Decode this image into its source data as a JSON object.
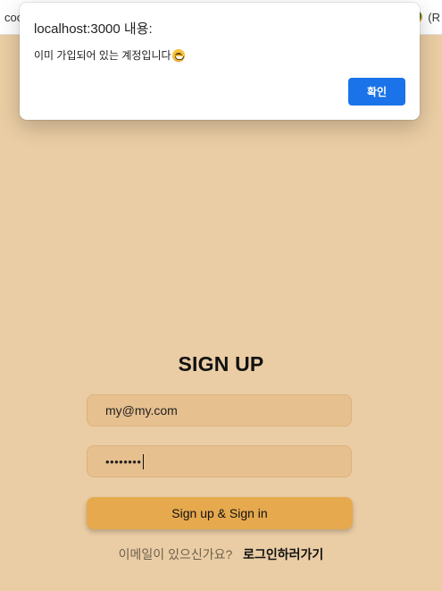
{
  "browser": {
    "bookmark_left_text": "coo",
    "bookmark_right_text": "(R",
    "globe_icon": "globe-icon"
  },
  "dialog": {
    "title": "localhost:3000 내용:",
    "message": "이미 가입되어 있는 계정입니다",
    "message_emoji": "grinning-sweat-emoji",
    "ok_label": "확인",
    "ok_color": "#1a73e8"
  },
  "form": {
    "title": "SIGN UP",
    "email_value": "my@my.com",
    "password_masked": "••••••••",
    "submit_label": "Sign up & Sign in",
    "footer_question": "이메일이 있으신가요?",
    "footer_link": "로그인하러가기"
  },
  "colors": {
    "background": "#eacda4",
    "field": "#e7c08f",
    "button": "#e6a94e"
  }
}
